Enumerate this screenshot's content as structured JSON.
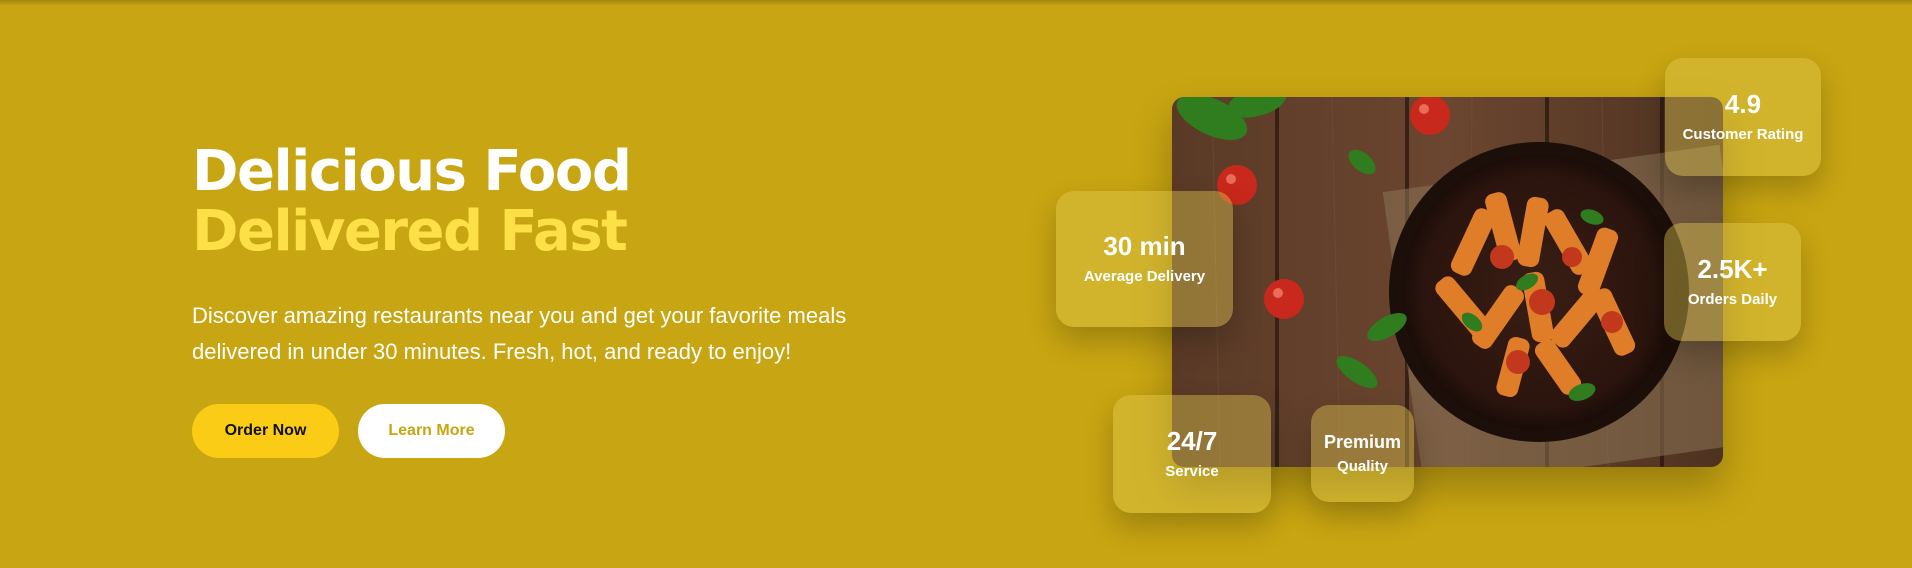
{
  "hero": {
    "title_line1": "Delicious Food",
    "title_line2": "Delivered Fast",
    "subtitle": "Discover amazing restaurants near you and get your favorite meals delivered in under 30 minutes. Fresh, hot, and ready to enjoy!",
    "primary_button": "Order Now",
    "secondary_button": "Learn More"
  },
  "image": {
    "name": "pasta-dish-photo"
  },
  "stats": [
    {
      "value": "4.9",
      "label": "Customer Rating"
    },
    {
      "value": "30 min",
      "label": "Average Delivery"
    },
    {
      "value": "2.5K+",
      "label": "Orders Daily"
    },
    {
      "value": "24/7",
      "label": "Service"
    },
    {
      "value": "Premium",
      "label": "Quality"
    }
  ],
  "colors": {
    "background": "#c8a512",
    "accent_yellow": "#fde047",
    "button_primary": "#facc15",
    "button_secondary": "#ffffff"
  }
}
